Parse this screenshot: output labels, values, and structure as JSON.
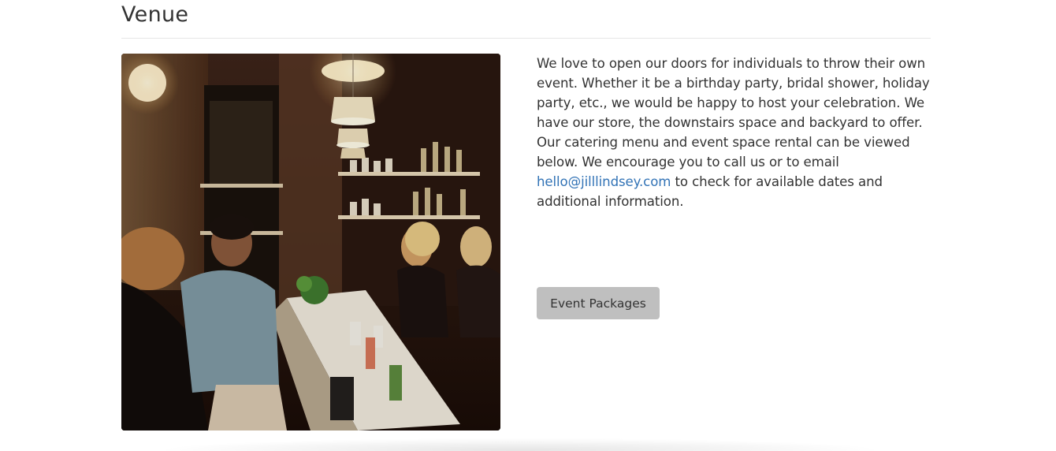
{
  "section": {
    "title": "Venue"
  },
  "description": {
    "text_before": "We love to open our doors for individuals to throw their own event. Whether it be a birthday party, bridal shower, holiday party, etc., we would be happy to host your celebration. We have our store, the downstairs space and backyard to offer. Our catering menu and event space rental can be viewed below. We encourage you to call us or to email ",
    "email_link": "hello@jilllindsey.com",
    "text_after": " to check for available dates and additional information."
  },
  "actions": {
    "event_packages_label": "Event Packages"
  },
  "colors": {
    "link": "#3273b6",
    "button_bg": "#bfbfbf",
    "text": "#333333"
  }
}
